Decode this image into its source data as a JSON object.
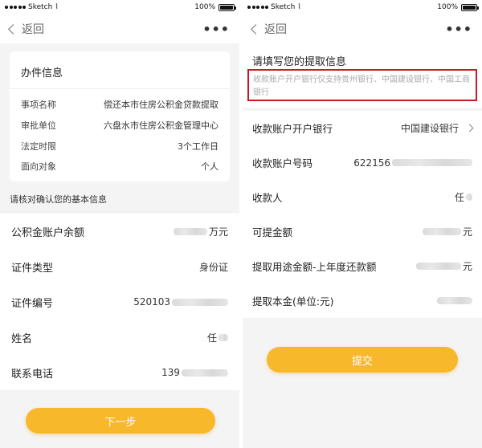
{
  "status_bar": {
    "carrier": "Sketch",
    "battery": "100%"
  },
  "nav": {
    "back_label": "返回",
    "more_label": "•••"
  },
  "left": {
    "card_title": "办件信息",
    "info_rows": [
      {
        "label": "事项名称",
        "value": "偿还本市住房公积金贷款提取"
      },
      {
        "label": "审批单位",
        "value": "六盘水市住房公积金管理中心"
      },
      {
        "label": "法定时限",
        "value": "3个工作日"
      },
      {
        "label": "面向对象",
        "value": "个人"
      }
    ],
    "section_label": "请核对确认您的基本信息",
    "rows": [
      {
        "label": "公积金账户余额",
        "value_suffix": "万元"
      },
      {
        "label": "证件类型",
        "value": "身份证"
      },
      {
        "label": "证件编号",
        "value_prefix": "520103"
      },
      {
        "label": "姓名",
        "value_prefix": "任"
      },
      {
        "label": "联系电话",
        "value_prefix": "139"
      }
    ],
    "next_button": "下一步"
  },
  "right": {
    "form_title": "请填写您的提取信息",
    "notice": "收款账户开户银行仅支持贵州银行、中国建设银行、中国工商银行",
    "rows": [
      {
        "label": "收款账户开户银行",
        "value": "中国建设银行"
      },
      {
        "label": "收款账户号码",
        "value_prefix": "622156"
      },
      {
        "label": "收款人",
        "value_prefix": "任"
      },
      {
        "label": "可提金额",
        "value_suffix": "元"
      },
      {
        "label": "提取用途金额-上年度还款额",
        "value_suffix": "元"
      },
      {
        "label": "提取本金(单位:元)",
        "value_suffix": ""
      }
    ],
    "submit_button": "提交"
  },
  "colors": {
    "accent": "#f8b82c",
    "highlight_border": "#c9191e"
  }
}
